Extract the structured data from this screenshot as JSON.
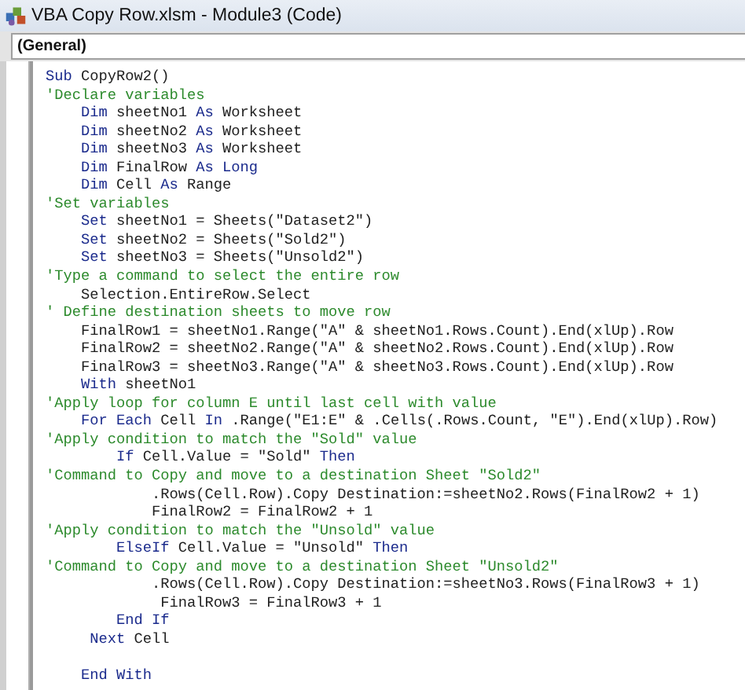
{
  "window": {
    "title": "VBA Copy Row.xlsm - Module3 (Code)"
  },
  "object_dropdown": {
    "value": "(General)"
  },
  "code_lines": [
    {
      "kind": "code",
      "segments": [
        {
          "kind": "keyword",
          "text": "Sub"
        },
        {
          "kind": "plain",
          "text": " CopyRow2()"
        }
      ]
    },
    {
      "kind": "code",
      "segments": [
        {
          "kind": "comment",
          "text": "'Declare variables"
        }
      ]
    },
    {
      "kind": "code",
      "segments": [
        {
          "kind": "keyword",
          "text": "    Dim"
        },
        {
          "kind": "plain",
          "text": " sheetNo1 "
        },
        {
          "kind": "keyword",
          "text": "As"
        },
        {
          "kind": "plain",
          "text": " Worksheet"
        }
      ]
    },
    {
      "kind": "code",
      "segments": [
        {
          "kind": "keyword",
          "text": "    Dim"
        },
        {
          "kind": "plain",
          "text": " sheetNo2 "
        },
        {
          "kind": "keyword",
          "text": "As"
        },
        {
          "kind": "plain",
          "text": " Worksheet"
        }
      ]
    },
    {
      "kind": "code",
      "segments": [
        {
          "kind": "keyword",
          "text": "    Dim"
        },
        {
          "kind": "plain",
          "text": " sheetNo3 "
        },
        {
          "kind": "keyword",
          "text": "As"
        },
        {
          "kind": "plain",
          "text": " Worksheet"
        }
      ]
    },
    {
      "kind": "code",
      "segments": [
        {
          "kind": "keyword",
          "text": "    Dim"
        },
        {
          "kind": "plain",
          "text": " FinalRow "
        },
        {
          "kind": "keyword",
          "text": "As Long"
        }
      ]
    },
    {
      "kind": "code",
      "segments": [
        {
          "kind": "keyword",
          "text": "    Dim"
        },
        {
          "kind": "plain",
          "text": " Cell "
        },
        {
          "kind": "keyword",
          "text": "As"
        },
        {
          "kind": "plain",
          "text": " Range"
        }
      ]
    },
    {
      "kind": "code",
      "segments": [
        {
          "kind": "comment",
          "text": "'Set variables"
        }
      ]
    },
    {
      "kind": "code",
      "segments": [
        {
          "kind": "keyword",
          "text": "    Set"
        },
        {
          "kind": "plain",
          "text": " sheetNo1 = Sheets(\"Dataset2\")"
        }
      ]
    },
    {
      "kind": "code",
      "segments": [
        {
          "kind": "keyword",
          "text": "    Set"
        },
        {
          "kind": "plain",
          "text": " sheetNo2 = Sheets(\"Sold2\")"
        }
      ]
    },
    {
      "kind": "code",
      "segments": [
        {
          "kind": "keyword",
          "text": "    Set"
        },
        {
          "kind": "plain",
          "text": " sheetNo3 = Sheets(\"Unsold2\")"
        }
      ]
    },
    {
      "kind": "code",
      "segments": [
        {
          "kind": "comment",
          "text": "'Type a command to select the entire row"
        }
      ]
    },
    {
      "kind": "code",
      "segments": [
        {
          "kind": "plain",
          "text": "    Selection.EntireRow.Select"
        }
      ]
    },
    {
      "kind": "code",
      "segments": [
        {
          "kind": "comment",
          "text": "' Define destination sheets to move row"
        }
      ]
    },
    {
      "kind": "code",
      "segments": [
        {
          "kind": "plain",
          "text": "    FinalRow1 = sheetNo1.Range(\"A\" & sheetNo1.Rows.Count).End(xlUp).Row"
        }
      ]
    },
    {
      "kind": "code",
      "segments": [
        {
          "kind": "plain",
          "text": "    FinalRow2 = sheetNo2.Range(\"A\" & sheetNo2.Rows.Count).End(xlUp).Row"
        }
      ]
    },
    {
      "kind": "code",
      "segments": [
        {
          "kind": "plain",
          "text": "    FinalRow3 = sheetNo3.Range(\"A\" & sheetNo3.Rows.Count).End(xlUp).Row"
        }
      ]
    },
    {
      "kind": "code",
      "segments": [
        {
          "kind": "keyword",
          "text": "    With"
        },
        {
          "kind": "plain",
          "text": " sheetNo1"
        }
      ]
    },
    {
      "kind": "code",
      "segments": [
        {
          "kind": "comment",
          "text": "'Apply loop for column E until last cell with value"
        }
      ]
    },
    {
      "kind": "code",
      "segments": [
        {
          "kind": "keyword",
          "text": "    For Each"
        },
        {
          "kind": "plain",
          "text": " Cell "
        },
        {
          "kind": "keyword",
          "text": "In"
        },
        {
          "kind": "plain",
          "text": " .Range(\"E1:E\" & .Cells(.Rows.Count, \"E\").End(xlUp).Row)"
        }
      ]
    },
    {
      "kind": "code",
      "segments": [
        {
          "kind": "comment",
          "text": "'Apply condition to match the \"Sold\" value"
        }
      ]
    },
    {
      "kind": "code",
      "segments": [
        {
          "kind": "keyword",
          "text": "        If"
        },
        {
          "kind": "plain",
          "text": " Cell.Value = \"Sold\" "
        },
        {
          "kind": "keyword",
          "text": "Then"
        }
      ]
    },
    {
      "kind": "code",
      "segments": [
        {
          "kind": "comment",
          "text": "'Command to Copy and move to a destination Sheet \"Sold2\""
        }
      ]
    },
    {
      "kind": "code",
      "segments": [
        {
          "kind": "plain",
          "text": "            .Rows(Cell.Row).Copy Destination:=sheetNo2.Rows(FinalRow2 + 1)"
        }
      ]
    },
    {
      "kind": "code",
      "segments": [
        {
          "kind": "plain",
          "text": "            FinalRow2 = FinalRow2 + 1"
        }
      ]
    },
    {
      "kind": "code",
      "segments": [
        {
          "kind": "comment",
          "text": "'Apply condition to match the \"Unsold\" value"
        }
      ]
    },
    {
      "kind": "code",
      "segments": [
        {
          "kind": "keyword",
          "text": "        ElseIf"
        },
        {
          "kind": "plain",
          "text": " Cell.Value = \"Unsold\" "
        },
        {
          "kind": "keyword",
          "text": "Then"
        }
      ]
    },
    {
      "kind": "code",
      "segments": [
        {
          "kind": "comment",
          "text": "'Command to Copy and move to a destination Sheet \"Unsold2\""
        }
      ]
    },
    {
      "kind": "code",
      "segments": [
        {
          "kind": "plain",
          "text": "            .Rows(Cell.Row).Copy Destination:=sheetNo3.Rows(FinalRow3 + 1)"
        }
      ]
    },
    {
      "kind": "code",
      "segments": [
        {
          "kind": "plain",
          "text": "             FinalRow3 = FinalRow3 + 1"
        }
      ]
    },
    {
      "kind": "code",
      "segments": [
        {
          "kind": "keyword",
          "text": "        End If"
        }
      ]
    },
    {
      "kind": "code",
      "segments": [
        {
          "kind": "keyword",
          "text": "     Next"
        },
        {
          "kind": "plain",
          "text": " Cell"
        }
      ]
    },
    {
      "kind": "blank"
    },
    {
      "kind": "code",
      "segments": [
        {
          "kind": "keyword",
          "text": "    End With"
        }
      ]
    }
  ]
}
